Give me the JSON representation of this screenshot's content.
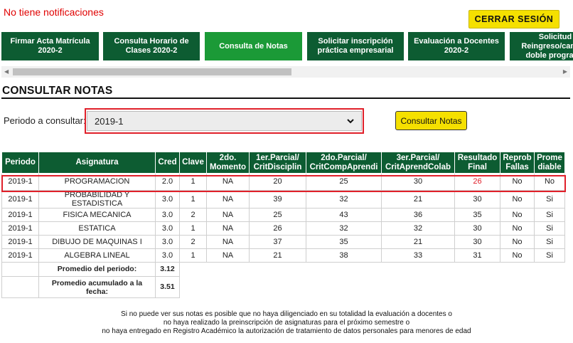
{
  "notifications": {
    "text": "No tiene notificaciones"
  },
  "header": {
    "logout_label": "CERRAR SESIÓN"
  },
  "tabs": [
    {
      "label": "Firmar Acta Matrícula 2020-2",
      "active": false
    },
    {
      "label": "Consulta Horario de Clases 2020-2",
      "active": false
    },
    {
      "label": "Consulta de Notas",
      "active": true
    },
    {
      "label": "Solicitar inscripción práctica empresarial",
      "active": false
    },
    {
      "label": "Evaluación a Docentes 2020-2",
      "active": false
    },
    {
      "label": "Solicitud Reingreso/cambio doble programa",
      "active": false
    }
  ],
  "page": {
    "title": "CONSULTAR NOTAS"
  },
  "filter": {
    "period_label": "Periodo a consultar:",
    "period_value": "2019-1",
    "submit_label": "Consultar Notas"
  },
  "table": {
    "headers": [
      "Periodo",
      "Asignatura",
      "Cred",
      "Clave",
      "2do. Momento",
      "1er.Parcial/ CritDisciplin",
      "2do.Parcial/ CritCompAprendi",
      "3er.Parcial/ CritAprendColab",
      "Resultado Final",
      "Reprob Fallas",
      "Prome diable"
    ],
    "rows": [
      {
        "periodo": "2019-1",
        "asignatura": "PROGRAMACION",
        "cred": "2.0",
        "clave": "1",
        "momento": "NA",
        "p1": "20",
        "p2": "25",
        "p3": "30",
        "final": "26",
        "reprob": "No",
        "promediable": "No"
      },
      {
        "periodo": "2019-1",
        "asignatura": "PROBABILIDAD Y ESTADISTICA",
        "cred": "3.0",
        "clave": "1",
        "momento": "NA",
        "p1": "39",
        "p2": "32",
        "p3": "21",
        "final": "30",
        "reprob": "No",
        "promediable": "Si"
      },
      {
        "periodo": "2019-1",
        "asignatura": "FISICA MECANICA",
        "cred": "3.0",
        "clave": "2",
        "momento": "NA",
        "p1": "25",
        "p2": "43",
        "p3": "36",
        "final": "35",
        "reprob": "No",
        "promediable": "Si"
      },
      {
        "periodo": "2019-1",
        "asignatura": "ESTATICA",
        "cred": "3.0",
        "clave": "1",
        "momento": "NA",
        "p1": "26",
        "p2": "32",
        "p3": "32",
        "final": "30",
        "reprob": "No",
        "promediable": "Si"
      },
      {
        "periodo": "2019-1",
        "asignatura": "DIBUJO DE MAQUINAS I",
        "cred": "3.0",
        "clave": "2",
        "momento": "NA",
        "p1": "37",
        "p2": "35",
        "p3": "21",
        "final": "30",
        "reprob": "No",
        "promediable": "Si"
      },
      {
        "periodo": "2019-1",
        "asignatura": "ALGEBRA LINEAL",
        "cred": "3.0",
        "clave": "1",
        "momento": "NA",
        "p1": "21",
        "p2": "38",
        "p3": "33",
        "final": "31",
        "reprob": "No",
        "promediable": "Si"
      }
    ],
    "summary": {
      "period_avg_label": "Promedio del periodo:",
      "period_avg_value": "3.12",
      "cumulative_avg_label": "Promedio acumulado a la fecha:",
      "cumulative_avg_value": "3.51"
    }
  },
  "footnote": [
    "Si no puede ver sus notas es posible que no haya diligenciado en su totalidad la evaluación a docentes o",
    "no haya realizado la preinscripción de asignaturas para el próximo semestre o",
    "no haya entregado en Registro Académico la autorización de tratamiento de datos personales para menores de edad"
  ],
  "colors": {
    "primary_green": "#0d5c32",
    "active_green": "#1b9a37",
    "yellow": "#f5e000",
    "highlight_red": "#e0202a"
  },
  "icons": {
    "select": "chevron-down-icon",
    "scroll_left": "arrow-left-icon",
    "scroll_right": "arrow-right-icon"
  }
}
